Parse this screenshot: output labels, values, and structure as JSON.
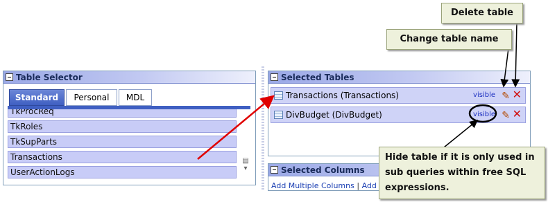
{
  "table_selector": {
    "title": "Table Selector",
    "tabs": [
      {
        "label": "Standard",
        "active": true
      },
      {
        "label": "Personal",
        "active": false
      },
      {
        "label": "MDL",
        "active": false
      }
    ],
    "items": [
      "TkProcReq",
      "TkRoles",
      "TkSupParts",
      "Transactions",
      "UserActionLogs"
    ]
  },
  "selected_tables": {
    "title": "Selected Tables",
    "rows": [
      {
        "name": "Transactions (Transactions)",
        "visibility": "visible"
      },
      {
        "name": "DivBudget (DivBudget)",
        "visibility": "visible"
      }
    ]
  },
  "selected_columns": {
    "title": "Selected Columns",
    "add_multiple_label": "Add Multiple Columns",
    "separator": "|",
    "add_free_label": "Add Fre"
  },
  "callouts": {
    "delete_table": "Delete table",
    "change_table_name": "Change table name",
    "hide_table": "Hide table if it is only used in sub queries within free SQL expressions."
  },
  "colors": {
    "accent": "#3f5fc2",
    "row_bg": "#cfd3f7",
    "link": "#1b2ec0",
    "arrow_red": "#e00000",
    "delete_red": "#d01010"
  }
}
